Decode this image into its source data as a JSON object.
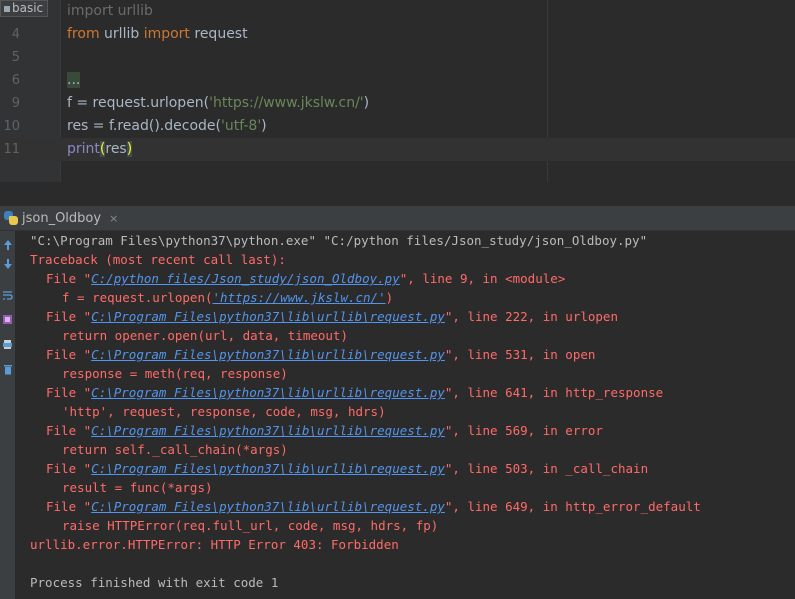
{
  "editor": {
    "tab_label": "basic",
    "lines": [
      {
        "num": "",
        "text": "import urllib"
      },
      {
        "num": "4",
        "pre": "from",
        "mod": " urllib ",
        "kw2": "import",
        "post": " request"
      },
      {
        "num": "5"
      },
      {
        "num": "6",
        "text": "..."
      },
      {
        "num": "9",
        "a": "f = request.urlopen(",
        "s": "'https://www.jkslw.cn/'",
        "b": ")"
      },
      {
        "num": "10",
        "a": "res = f.read().decode(",
        "s": "'utf-8'",
        "b": ")"
      },
      {
        "num": "11",
        "fn": "print",
        "p1": "(",
        "arg": "res",
        "p2": ")"
      }
    ]
  },
  "run_panel": {
    "tab_label": "json_Oldboy",
    "close_glyph": "×",
    "toolbar_icons": [
      "up-arrow-icon",
      "down-arrow-icon",
      "wrap-icon",
      "settings-icon",
      "print-icon",
      "trash-icon"
    ]
  },
  "console": {
    "cmd": "\"C:\\Program Files\\python37\\python.exe\" \"C:/python files/Json_study/json_Oldboy.py\"",
    "traceback": "Traceback (most recent call last):",
    "file_word": "File ",
    "q": "\"",
    "frames": [
      {
        "path": "C:/python files/Json_study/json_Oldboy.py",
        "tail": ", line 9, in <module>",
        "code_a": "f = request.urlopen(",
        "code_link": "'https://www.jkslw.cn/'",
        "code_b": ")"
      },
      {
        "path": "C:\\Program Files\\python37\\lib\\urllib\\request.py",
        "tail": ", line 222, in urlopen",
        "code": "return opener.open(url, data, timeout)"
      },
      {
        "path": "C:\\Program Files\\python37\\lib\\urllib\\request.py",
        "tail": ", line 531, in open",
        "code": "response = meth(req, response)"
      },
      {
        "path": "C:\\Program Files\\python37\\lib\\urllib\\request.py",
        "tail": ", line 641, in http_response",
        "code": "'http', request, response, code, msg, hdrs)"
      },
      {
        "path": "C:\\Program Files\\python37\\lib\\urllib\\request.py",
        "tail": ", line 569, in error",
        "code": "return self._call_chain(*args)"
      },
      {
        "path": "C:\\Program Files\\python37\\lib\\urllib\\request.py",
        "tail": ", line 503, in _call_chain",
        "code": "result = func(*args)"
      },
      {
        "path": "C:\\Program Files\\python37\\lib\\urllib\\request.py",
        "tail": ", line 649, in http_error_default",
        "code": "raise HTTPError(req.full_url, code, msg, hdrs, fp)"
      }
    ],
    "error": "urllib.error.HTTPError: HTTP Error 403: Forbidden",
    "exit": "Process finished with exit code 1"
  }
}
